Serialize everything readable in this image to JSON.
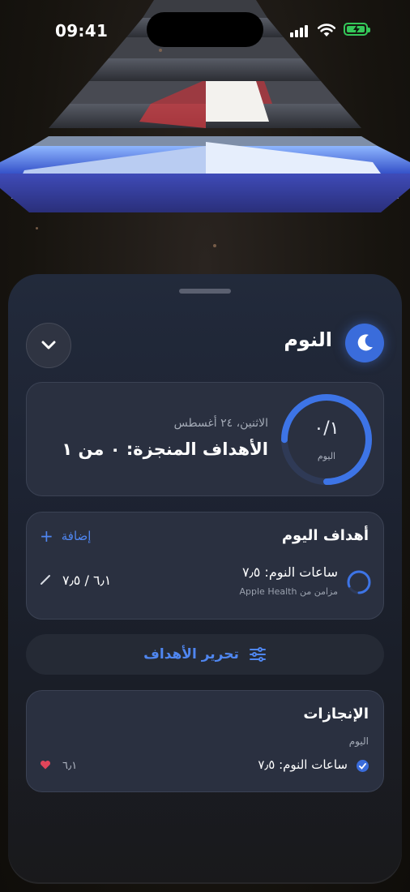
{
  "status_bar": {
    "time": "09:41"
  },
  "sheet": {
    "title": "النوم",
    "summary": {
      "ring_value": "٠/١",
      "ring_label": "اليوم",
      "date": "الاثنين، ٢٤ أغسطس",
      "achieved": "الأهداف المنجزة: ٠ من ١"
    },
    "goals": {
      "title": "أهداف اليوم",
      "add_label": "إضافة",
      "items": [
        {
          "name": "ساعات النوم: ٧٫٥",
          "source": "مزامن من Apple Health",
          "value": "٦٫١ / ٧٫٥"
        }
      ]
    },
    "edit_goals_label": "تحرير الأهداف",
    "achievements": {
      "title": "الإنجازات",
      "day": "اليوم",
      "items": [
        {
          "text": "ساعات النوم: ٧٫٥",
          "value": "٦٫١"
        }
      ]
    }
  },
  "colors": {
    "accent": "#3a6cdb",
    "link": "#4f86f0",
    "battery": "#34c759",
    "heart": "#e0455a"
  },
  "icons": [
    "moon-icon",
    "chevron-down-icon",
    "plus-icon",
    "pencil-icon",
    "sliders-icon",
    "check-icon",
    "heart-icon"
  ]
}
